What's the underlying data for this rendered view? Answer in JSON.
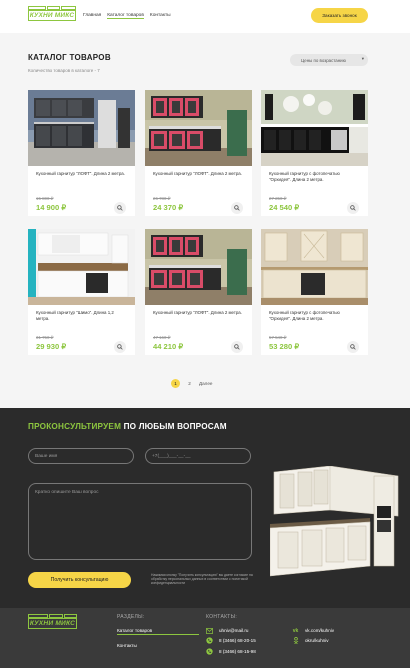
{
  "header": {
    "logo_text": "КУХНИ МИКС",
    "nav": [
      "Главная",
      "Каталог товаров",
      "Контакты"
    ],
    "call_button": "Заказать звонок"
  },
  "catalog": {
    "title": "КАТАЛОГ ТОВАРОВ",
    "count_text": "Количество товаров в каталоге - 7",
    "sort_label": "Цены по возрастанию",
    "products": [
      {
        "name": "Кухонный гарнитур \"ЛОФТ\". Длина 2 метра.",
        "old_price": "15 800 ₽",
        "price": "14 900 ₽"
      },
      {
        "name": "Кухонный гарнитур \"ЛОФТ\". Длина 2 метра.",
        "old_price": "26 780 ₽",
        "price": "24 370 ₽"
      },
      {
        "name": "Кухонный гарнитур с фотопечатью \"Орхидея\". Длина 2 метра.",
        "old_price": "27 250 ₽",
        "price": "24 540 ₽"
      },
      {
        "name": "Кухонный гарнитур \"Шимо\". Длина 1,2 метра.",
        "old_price": "31 750 ₽",
        "price": "29 930 ₽"
      },
      {
        "name": "Кухонный гарнитур \"ЛОФТ\". Длина 2 метра.",
        "old_price": "47 160 ₽",
        "price": "44 210 ₽"
      },
      {
        "name": "Кухонный гарнитур с фотопечатью \"Орхидея\". Длина 2 метра.",
        "old_price": "57 540 ₽",
        "price": "53 280 ₽"
      }
    ],
    "pagination": {
      "pages": [
        "1",
        "2"
      ],
      "next": "Далее"
    }
  },
  "consult": {
    "title_highlight": "ПРОКОНСУЛЬТИРУЕМ",
    "title_rest": "ПО ЛЮБЫМ ВОПРОСАМ",
    "name_placeholder": "Ваше имя",
    "phone_placeholder": "+7(___)___-__-__",
    "question_placeholder": "Кратко опишите Ваш вопрос",
    "button": "Получить консультацию",
    "disclaimer": "Нажимая кнопку \"Получить консультацию\" вы даете согласие на обработку персональных данных в соответствии с политикой конфиденциальности"
  },
  "footer": {
    "logo_text": "КУХНИ МИКС",
    "sections_title": "РАЗДЕЛЫ:",
    "sections": [
      "Каталог товаров",
      "Контакты"
    ],
    "contacts_title": "КОНТАКТЫ:",
    "email": "uhniv@mail.ru",
    "phone1": "8 (3466) 68-20-15",
    "phone2": "8 (3466) 68-15-98",
    "vk": "vk.com/kuhniv",
    "ok": "okru/kuhniv"
  },
  "colors": {
    "accent": "#8dc63f",
    "button": "#f6d547",
    "dark": "#2b2b2b"
  }
}
